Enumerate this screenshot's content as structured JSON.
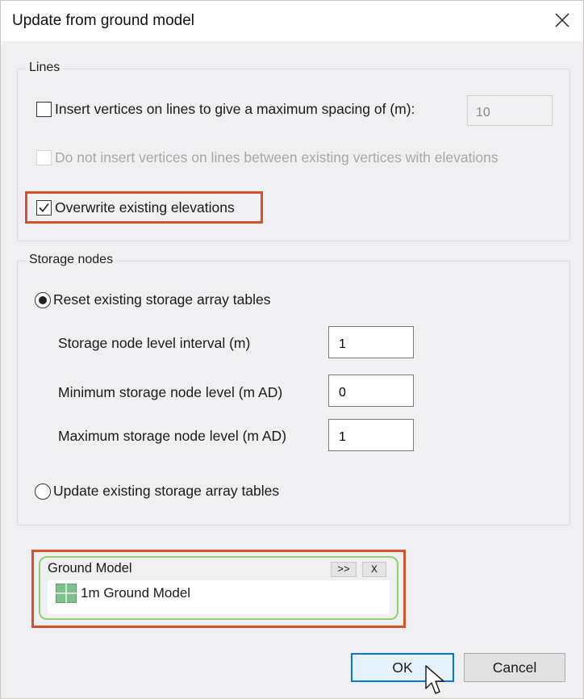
{
  "window": {
    "title": "Update from ground model",
    "close_icon": "close-x-icon"
  },
  "lines_group": {
    "label": "Lines",
    "insert_vertices": {
      "label": "Insert vertices on lines to give a maximum spacing of (m):",
      "checked": false,
      "spacing_value": "10",
      "spacing_disabled": true
    },
    "do_not_insert": {
      "label": "Do not insert vertices on lines between existing vertices with elevations",
      "checked": false,
      "disabled": true
    },
    "overwrite_elevations": {
      "label": "Overwrite existing elevations",
      "checked": true,
      "highlighted": true
    }
  },
  "storage_group": {
    "label": "Storage nodes",
    "reset_option": {
      "label": "Reset existing storage array tables",
      "selected": true
    },
    "fields": [
      {
        "label": "Storage node level interval (m)",
        "value": "1"
      },
      {
        "label": "Minimum storage node level (m AD)",
        "value": "0"
      },
      {
        "label": "Maximum storage node level (m AD)",
        "value": "1"
      }
    ],
    "update_option": {
      "label": "Update existing storage array tables",
      "selected": false
    }
  },
  "ground_model": {
    "title": "Ground Model",
    "expand_label": ">>",
    "clear_label": "X",
    "items": [
      {
        "label": "1m Ground Model",
        "icon": "grid-ground-model-icon"
      }
    ],
    "highlighted": true
  },
  "buttons": {
    "ok_label": "OK",
    "cancel_label": "Cancel"
  },
  "colors": {
    "highlight": "#d6502a",
    "panel_border": "#8fd16b",
    "default_button_border": "#0078d7"
  }
}
